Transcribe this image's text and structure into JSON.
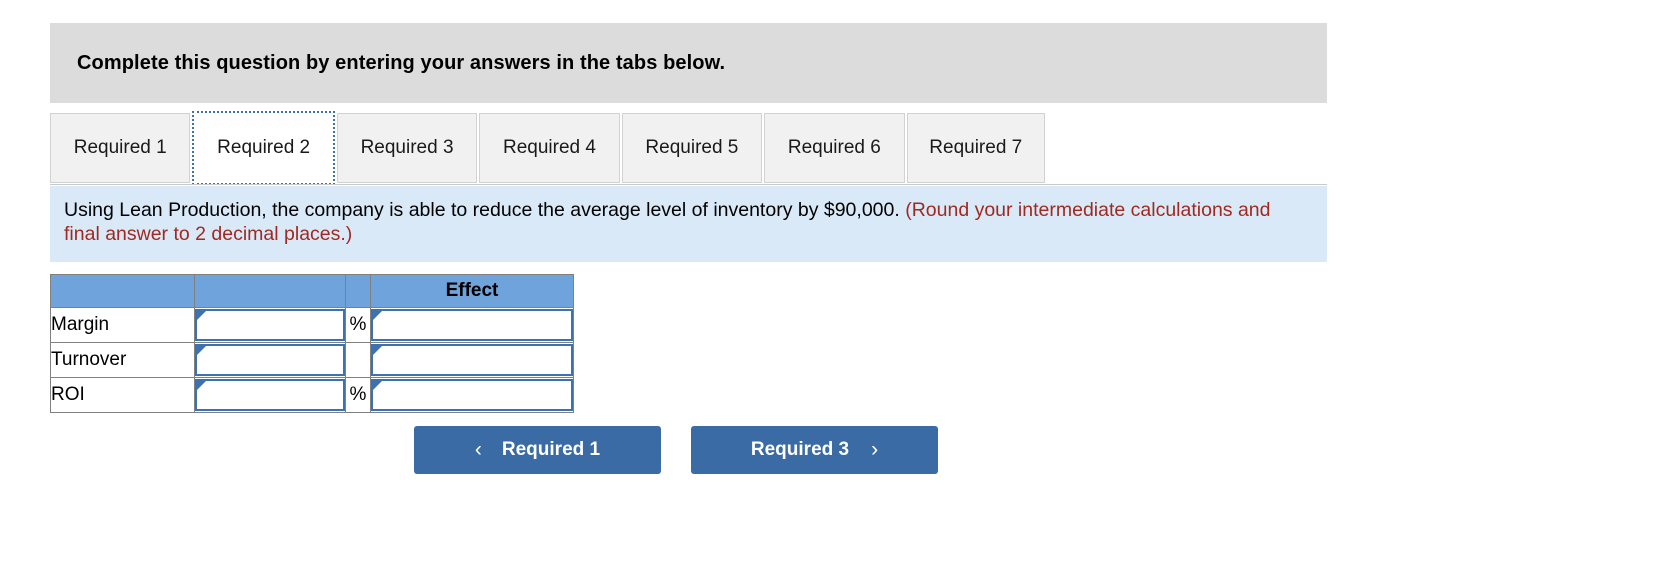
{
  "banner": {
    "text": "Complete this question by entering your answers in the tabs below."
  },
  "tabs": {
    "active_index": 1,
    "items": [
      {
        "label": "Required 1"
      },
      {
        "label": "Required 2"
      },
      {
        "label": "Required 3"
      },
      {
        "label": "Required 4"
      },
      {
        "label": "Required 5"
      },
      {
        "label": "Required 6"
      },
      {
        "label": "Required 7"
      }
    ]
  },
  "instruction": {
    "main": "Using Lean Production, the company is able to reduce the average level of inventory by $90,000.",
    "note": "(Round your intermediate calculations and final answer to 2 decimal places.)"
  },
  "table": {
    "headers": [
      "",
      "",
      "",
      "Effect"
    ],
    "rows": [
      {
        "label": "Margin",
        "value": "",
        "unit": "%",
        "effect": ""
      },
      {
        "label": "Turnover",
        "value": "",
        "unit": "",
        "effect": ""
      },
      {
        "label": "ROI",
        "value": "",
        "unit": "%",
        "effect": ""
      }
    ]
  },
  "nav": {
    "prev_label": "Required 1",
    "prev_icon": "chevron-left-icon",
    "prev_chevron": "‹",
    "next_label": "Required 3",
    "next_icon": "chevron-right-icon",
    "next_chevron": "›"
  },
  "colors": {
    "banner_bg": "#dcdcdc",
    "instruction_bg": "#d9e9f7",
    "note_red": "#9e2a21",
    "table_header_blue": "#6fa3dc",
    "input_border_blue": "#3d72b0",
    "button_blue": "#3b6ba5"
  }
}
